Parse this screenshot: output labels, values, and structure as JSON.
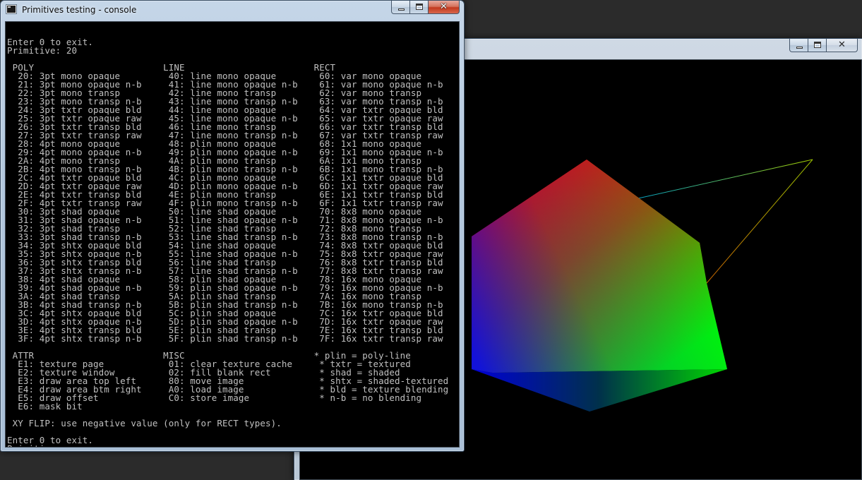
{
  "console_window": {
    "title": "Primitives testing - console",
    "lines": [
      "",
      "Enter 0 to exit.",
      "Primitive: 20",
      "",
      " POLY                        LINE                        RECT",
      "  20: 3pt mono opaque         40: line mono opaque        60: var mono opaque",
      "  21: 3pt mono opaque n-b     41: line mono opaque n-b    61: var mono opaque n-b",
      "  22: 3pt mono transp         42: line mono transp        62: var mono transp",
      "  23: 3pt mono transp n-b     43: line mono transp n-b    63: var mono transp n-b",
      "  24: 3pt txtr opaque bld     44: line mono opaque        64: var txtr opaque bld",
      "  25: 3pt txtr opaque raw     45: line mono opaque n-b    65: var txtr opaque raw",
      "  26: 3pt txtr transp bld     46: line mono transp        66: var txtr transp bld",
      "  27: 3pt txtr transp raw     47: line mono transp n-b    67: var txtr transp raw",
      "  28: 4pt mono opaque         48: plin mono opaque        68: 1x1 mono opaque",
      "  29: 4pt mono opaque n-b     49: plin mono opaque n-b    69: 1x1 mono opaque n-b",
      "  2A: 4pt mono transp         4A: plin mono transp        6A: 1x1 mono transp",
      "  2B: 4pt mono transp n-b     4B: plin mono transp n-b    6B: 1x1 mono transp n-b",
      "  2C: 4pt txtr opaque bld     4C: plin mono opaque        6C: 1x1 txtr opaque bld",
      "  2D: 4pt txtr opaque raw     4D: plin mono opaque n-b    6D: 1x1 txtr opaque raw",
      "  2E: 4pt txtr transp bld     4E: plin mono transp        6E: 1x1 txtr transp bld",
      "  2F: 4pt txtr transp raw     4F: plin mono transp n-b    6F: 1x1 txtr transp raw",
      "  30: 3pt shad opaque         50: line shad opaque        70: 8x8 mono opaque",
      "  31: 3pt shad opaque n-b     51: line shad opaque n-b    71: 8x8 mono opaque n-b",
      "  32: 3pt shad transp         52: line shad transp        72: 8x8 mono transp",
      "  33: 3pt shad transp n-b     53: line shad transp n-b    73: 8x8 mono transp n-b",
      "  34: 3pt shtx opaque bld     54: line shad opaque        74: 8x8 txtr opaque bld",
      "  35: 3pt shtx opaque n-b     55: line shad opaque n-b    75: 8x8 txtr opaque raw",
      "  36: 3pt shtx transp bld     56: line shad transp        76: 8x8 txtr transp bld",
      "  37: 3pt shtx transp n-b     57: line shad transp n-b    77: 8x8 txtr transp raw",
      "  38: 4pt shad opaque         58: plin shad opaque        78: 16x mono opaque",
      "  39: 4pt shad opaque n-b     59: plin shad opaque n-b    79: 16x mono opaque n-b",
      "  3A: 4pt shad transp         5A: plin shad transp        7A: 16x mono transp",
      "  3B: 4pt shad transp n-b     5B: plin shad transp n-b    7B: 16x mono transp n-b",
      "  3C: 4pt shtx opaque bld     5C: plin shad opaque        7C: 16x txtr opaque bld",
      "  3D: 4pt shtx opaque n-b     5D: plin shad opaque n-b    7D: 16x txtr opaque raw",
      "  3E: 4pt shtx transp bld     5E: plin shad transp        7E: 16x txtr transp bld",
      "  3F: 4pt shtx transp n-b     5F: plin shad transp n-b    7F: 16x txtr transp raw",
      "",
      " ATTR                        MISC                        * plin = poly-line",
      "  E1: texture page            01: clear texture cache     * txtr = textured",
      "  E2: texture window          02: fill blank rect         * shad = shaded",
      "  E3: draw area top left      80: move image              * shtx = shaded-textured",
      "  E4: draw area btm right     A0: load image              * bld = texture blending",
      "  E5: draw offset             C0: store image             * n-b = no blending",
      "  E6: mask bit",
      "",
      " XY FLIP: use negative value (only for RECT types).",
      "",
      "Enter 0 to exit.",
      "Primitive: "
    ]
  },
  "render_window": {
    "title": ""
  },
  "caption_buttons": {
    "minimize_icon": "minimize-icon",
    "maximize_icon": "maximize-icon",
    "close_glyph": "✕"
  },
  "colors": {
    "console_bg": "#000000",
    "console_text": "#c0c0c0",
    "vertex_red": "#ff0000",
    "vertex_green": "#00ff00",
    "vertex_blue": "#0000ff",
    "line_color_a": "#c8c800",
    "line_color_b": "#00c8c8"
  }
}
